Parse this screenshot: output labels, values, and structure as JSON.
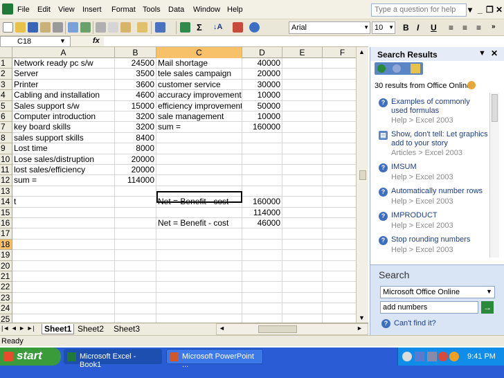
{
  "menu": {
    "items": [
      "File",
      "Edit",
      "View",
      "Insert",
      "Format",
      "Tools",
      "Data",
      "Window",
      "Help"
    ],
    "ask_placeholder": "Type a question for help"
  },
  "format": {
    "font": "Arial",
    "size": "10"
  },
  "formula_bar": {
    "name_box": "C18",
    "fx": "fx"
  },
  "columns": [
    "A",
    "B",
    "C",
    "D",
    "E",
    "F"
  ],
  "rows": [
    [
      "Network ready pc s/w",
      "24500",
      "Mail shortage",
      "40000"
    ],
    [
      "Server",
      "3500",
      "tele sales campaign",
      "20000"
    ],
    [
      "Printer",
      "3600",
      "customer service",
      "30000"
    ],
    [
      "Cabling and installation",
      "4600",
      "accuracy improvement",
      "10000"
    ],
    [
      "Sales support s/w",
      "15000",
      "efficiency improvement",
      "50000"
    ],
    [
      "Computer introduction",
      "3200",
      "sale management",
      "10000"
    ],
    [
      "key board skills",
      "3200",
      "sum =",
      "160000"
    ],
    [
      "sales support skills",
      "8400",
      "",
      ""
    ],
    [
      "Lost time",
      "8000",
      "",
      ""
    ],
    [
      "Lose sales/distruption",
      "20000",
      "",
      ""
    ],
    [
      "lost sales/efficiency",
      "20000",
      "",
      ""
    ],
    [
      "sum =",
      "114000",
      "",
      ""
    ],
    [
      "",
      "",
      "",
      ""
    ],
    [
      "t",
      "",
      "Net = Benefit - cost",
      "160000"
    ],
    [
      "",
      "",
      "",
      "114000"
    ],
    [
      "",
      "",
      "Net = Benefit - cost",
      "46000"
    ],
    [
      "",
      "",
      "",
      ""
    ],
    [
      "",
      "",
      "",
      ""
    ],
    [
      "",
      "",
      "",
      ""
    ],
    [
      "",
      "",
      "",
      ""
    ],
    [
      "",
      "",
      "",
      ""
    ],
    [
      "",
      "",
      "",
      ""
    ],
    [
      "",
      "",
      "",
      ""
    ],
    [
      "",
      "",
      "",
      ""
    ],
    [
      "",
      "",
      "",
      ""
    ]
  ],
  "sheet_tabs": [
    "Sheet1",
    "Sheet2",
    "Sheet3"
  ],
  "status": "Ready",
  "taskpane": {
    "title": "Search Results",
    "count": "30 results from Office Online",
    "results": [
      {
        "title": "Examples of commonly used formulas",
        "sub": "Help > Excel 2003"
      },
      {
        "title": "Show, don't tell: Let graphics add to your story",
        "sub": "Articles > Excel 2003"
      },
      {
        "title": "IMSUM",
        "sub": "Help > Excel 2003"
      },
      {
        "title": "Automatically number rows",
        "sub": "Help > Excel 2003"
      },
      {
        "title": "IMPRODUCT",
        "sub": "Help > Excel 2003"
      },
      {
        "title": "Stop rounding numbers",
        "sub": "Help > Excel 2003"
      }
    ],
    "search_label": "Search",
    "search_scope": "Microsoft Office Online",
    "search_query": "add numbers",
    "cant_find": "Can't find it?"
  },
  "taskbar": {
    "start": "start",
    "tasks": [
      "Microsoft Excel - Book1",
      "Microsoft PowerPoint ..."
    ],
    "clock": "9:41 PM"
  },
  "colors": {
    "taskbar": "#2a5dd5",
    "start": "#3a9b3a",
    "selected_header": "#f7c16a"
  }
}
